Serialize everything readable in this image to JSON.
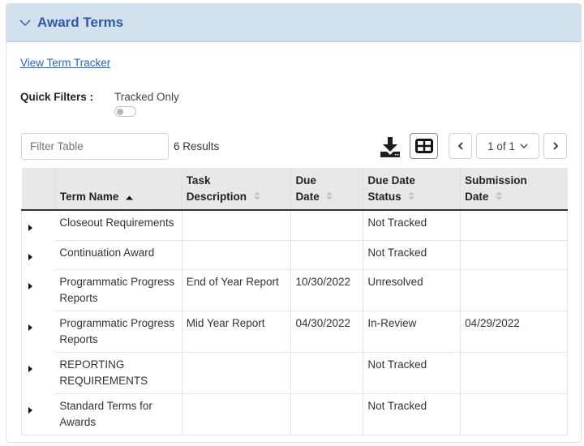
{
  "panel": {
    "title": "Award Terms",
    "header_color": "#d3e0ee",
    "title_color": "#2a5aa8"
  },
  "links": {
    "view_term_tracker": "View Term Tracker"
  },
  "quick_filters": {
    "label": "Quick Filters :",
    "options": [
      {
        "label": "Tracked Only",
        "checked": false
      }
    ]
  },
  "toolbar": {
    "filter_placeholder": "Filter Table",
    "filter_value": "",
    "results": "6 Results",
    "download_icon": "download-icon",
    "columns_icon": "table-columns-icon",
    "page_select": "1 of 1"
  },
  "table": {
    "columns": [
      {
        "line1": "",
        "line2": ""
      },
      {
        "line1": "",
        "line2": "Term Name",
        "sort": "asc"
      },
      {
        "line1": "Task",
        "line2": "Description",
        "sort": "none"
      },
      {
        "line1": "Due",
        "line2": "Date",
        "sort": "none"
      },
      {
        "line1": "Due Date",
        "line2": "Status",
        "sort": "none"
      },
      {
        "line1": "Submission",
        "line2": "Date",
        "sort": "none"
      }
    ],
    "rows": [
      {
        "term_name": "Closeout Requirements",
        "task_description": "",
        "due_date": "",
        "due_date_status": "Not Tracked",
        "submission_date": ""
      },
      {
        "term_name": "Continuation Award",
        "task_description": "",
        "due_date": "",
        "due_date_status": "Not Tracked",
        "submission_date": ""
      },
      {
        "term_name": "Programmatic Progress Reports",
        "task_description": "End of Year Report",
        "due_date": "10/30/2022",
        "due_date_status": "Unresolved",
        "submission_date": ""
      },
      {
        "term_name": "Programmatic Progress Reports",
        "task_description": "Mid Year Report",
        "due_date": "04/30/2022",
        "due_date_status": "In-Review",
        "submission_date": "04/29/2022"
      },
      {
        "term_name": "REPORTING REQUIREMENTS",
        "task_description": "",
        "due_date": "",
        "due_date_status": "Not Tracked",
        "submission_date": ""
      },
      {
        "term_name": "Standard Terms for Awards",
        "task_description": "",
        "due_date": "",
        "due_date_status": "Not Tracked",
        "submission_date": ""
      }
    ]
  }
}
